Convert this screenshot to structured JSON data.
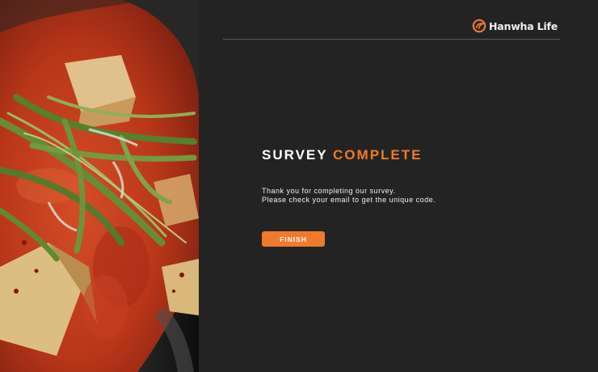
{
  "brand": {
    "name": "Hanwha Life",
    "logo_icon": "hanwha-flame-logo",
    "accent_color": "#ef7a2c"
  },
  "survey": {
    "title_part1": "SURVEY",
    "title_part2": "COMPLETE",
    "message_line1": "Thank you for completing our survey.",
    "message_line2": "Please check your email to get the unique code.",
    "finish_label": "FINISH"
  },
  "colors": {
    "background": "#232324",
    "accent": "#ef7a2c",
    "text": "#ffffff"
  }
}
